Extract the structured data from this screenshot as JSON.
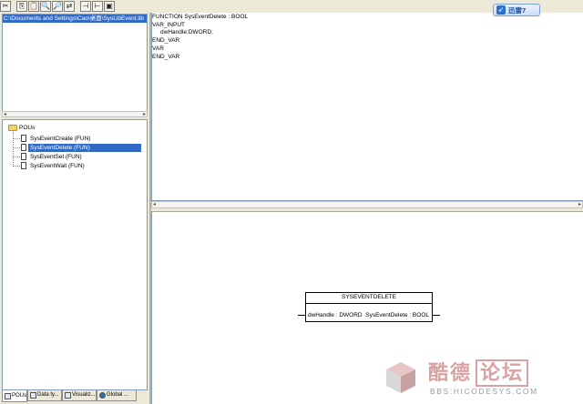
{
  "toolbar": {
    "buttons": [
      {
        "name": "cut-icon",
        "glyph": "✂"
      },
      {
        "name": "copy-icon",
        "glyph": "⎘"
      },
      {
        "name": "paste-icon",
        "glyph": "📋"
      },
      {
        "name": "find-icon",
        "glyph": "🔍"
      },
      {
        "name": "find-next-icon",
        "glyph": "🔎"
      },
      {
        "name": "replace-icon",
        "glyph": "⇄"
      },
      {
        "name": "insert-input-icon",
        "glyph": "⊣"
      },
      {
        "name": "insert-output-icon",
        "glyph": "⊢"
      },
      {
        "name": "insert-box-icon",
        "glyph": "▣"
      }
    ]
  },
  "library": {
    "path": "C:\\Documents and Settings\\Cao\\桌面\\SysLibEvent.lib"
  },
  "tree": {
    "root_label": "POUs",
    "items": [
      {
        "label": "SysEventCreate (FUN)",
        "selected": false
      },
      {
        "label": "SysEventDelete (FUN)",
        "selected": true
      },
      {
        "label": "SysEventSet (FUN)",
        "selected": false
      },
      {
        "label": "SysEventWait (FUN)",
        "selected": false
      }
    ]
  },
  "tabs": [
    {
      "label": "POUs",
      "active": true,
      "icon": "pou-icon"
    },
    {
      "label": "Data ty...",
      "active": false,
      "icon": "data-types-icon"
    },
    {
      "label": "Visualiz...",
      "active": false,
      "icon": "visualization-icon"
    },
    {
      "label": "Global ...",
      "active": false,
      "icon": "globe-icon"
    }
  ],
  "editor": {
    "lines": [
      "FUNCTION SysEventDelete : BOOL",
      "VAR_INPUT",
      "     dwHandle:DWORD;",
      "END_VAR",
      "VAR",
      "END_VAR"
    ]
  },
  "function_block": {
    "title": "SYSEVENTDELETE",
    "input": "dwHandle : DWORD",
    "output": "SysEventDelete : BOOL"
  },
  "badge": {
    "text": "迅雷7",
    "icon": "xunlei-icon"
  },
  "watermark": {
    "text_main": "酷德",
    "text_boxed": "论坛",
    "url": "BBS.HICODESYS.COM"
  },
  "colors": {
    "selection": "#316ac5",
    "watermark": "#d9a2a2"
  }
}
